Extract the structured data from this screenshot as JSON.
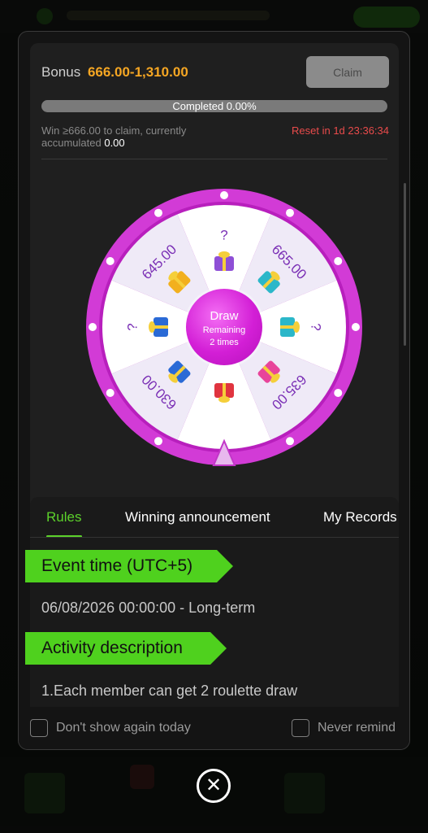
{
  "bonus": {
    "label": "Bonus",
    "range": "666.00-1,310.00",
    "claim_label": "Claim"
  },
  "progress": {
    "text": "Completed 0.00%",
    "fraction": 0.0
  },
  "win_note": {
    "prefix": "Win ≥666.00 to claim, currently accumulated",
    "accumulated": "0.00"
  },
  "reset": {
    "text": "Reset in 1d 23:36:34"
  },
  "wheel": {
    "segments": [
      {
        "label": "?",
        "gift": "purple-gift-icon"
      },
      {
        "label": "665.00",
        "gift": "teal-gift-icon"
      },
      {
        "label": "?",
        "gift": "teal-gift-icon"
      },
      {
        "label": "635.00",
        "gift": "pink-gift-icon"
      },
      {
        "label": "",
        "gift": "red-gift-icon"
      },
      {
        "label": "630.00",
        "gift": "blue-gift-icon"
      },
      {
        "label": "?",
        "gift": "blue-gift-icon"
      },
      {
        "label": "645.00",
        "gift": "gold-coin-icon"
      }
    ],
    "draw_label": "Draw",
    "remaining_label": "Remaining",
    "remaining_count": "2 times",
    "colors": {
      "rim": "#d23bd6",
      "segment_light": "#ffffff",
      "segment_dark": "#efeaf7",
      "text": "#7a2fb5"
    }
  },
  "tabs": {
    "items": [
      "Rules",
      "Winning announcement",
      "My Records"
    ],
    "active": "Rules",
    "accent": "#5cd12b"
  },
  "rules": {
    "event_time_heading": "Event time (UTC+5)",
    "event_time_value": "06/08/2026 00:00:00 - Long-term",
    "activity_heading": "Activity description",
    "activity_line1": "1.Each member can get 2 roulette draw"
  },
  "footer": {
    "dont_show": "Don't show again today",
    "never_remind": "Never remind"
  },
  "close": {
    "icon": "close-icon"
  }
}
